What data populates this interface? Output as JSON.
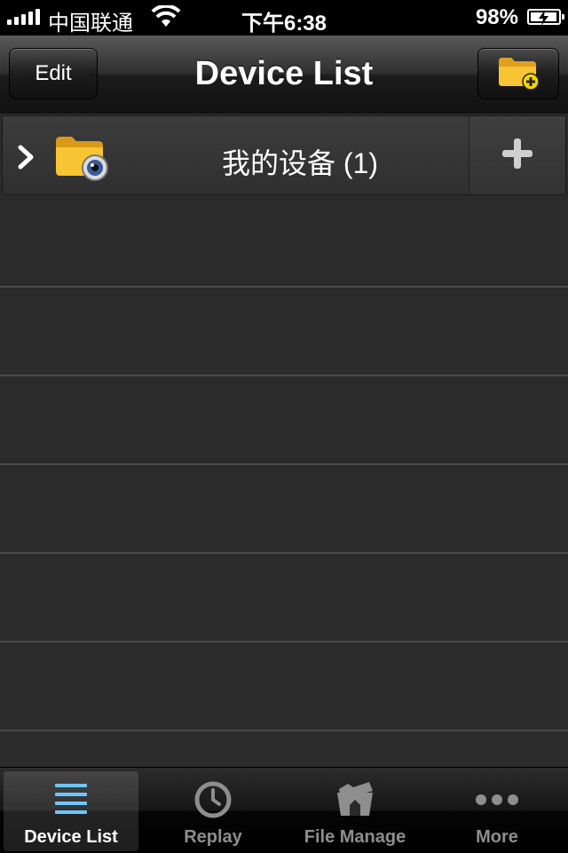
{
  "status_bar": {
    "carrier": "中国联通",
    "time": "下午6:38",
    "battery": "98%"
  },
  "nav_bar": {
    "edit_label": "Edit",
    "title": "Device List",
    "right_icon": "add-folder-icon"
  },
  "list": {
    "groups": [
      {
        "label": "我的设备 (1)",
        "icon": "camera-folder-icon",
        "action_icon": "plus-icon"
      }
    ],
    "empty_rows": 6
  },
  "tab_bar": {
    "tabs": [
      {
        "label": "Device List",
        "icon": "list-icon",
        "active": true
      },
      {
        "label": "Replay",
        "icon": "clock-icon",
        "active": false
      },
      {
        "label": "File Manage",
        "icon": "folders-icon",
        "active": false
      },
      {
        "label": "More",
        "icon": "more-dots-icon",
        "active": false
      }
    ]
  },
  "colors": {
    "accent_blue": "#6ec6ff",
    "folder_yellow": "#f7c434",
    "background": "#2b2b2b"
  }
}
